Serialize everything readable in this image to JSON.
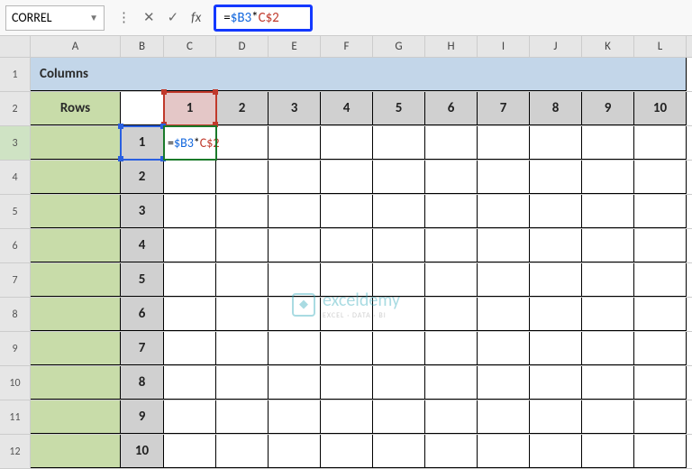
{
  "namebox": {
    "value": "CORREL"
  },
  "formula": {
    "equals": "=",
    "ref1": "$B3",
    "operator": "*",
    "ref2": "C$2"
  },
  "columns": [
    "A",
    "B",
    "C",
    "D",
    "E",
    "F",
    "G",
    "H",
    "I",
    "J",
    "K",
    "L"
  ],
  "rowNumbers": [
    "1",
    "2",
    "3",
    "4",
    "5",
    "6",
    "7",
    "8",
    "9",
    "10",
    "11",
    "12"
  ],
  "labels": {
    "columnsHeader": "Columns",
    "rowsHeader": "Rows"
  },
  "dataColHeaders": [
    "1",
    "2",
    "3",
    "4",
    "5",
    "6",
    "7",
    "8",
    "9",
    "10"
  ],
  "dataRowHeaders": [
    "1",
    "2",
    "3",
    "4",
    "5",
    "6",
    "7",
    "8",
    "9",
    "10"
  ],
  "cellFormula": {
    "equals": "=",
    "ref1": "$B3",
    "operator": "*",
    "ref2": "C$2"
  },
  "watermark": {
    "brand": "exceldemy",
    "tag": "EXCEL · DATA · BI"
  }
}
